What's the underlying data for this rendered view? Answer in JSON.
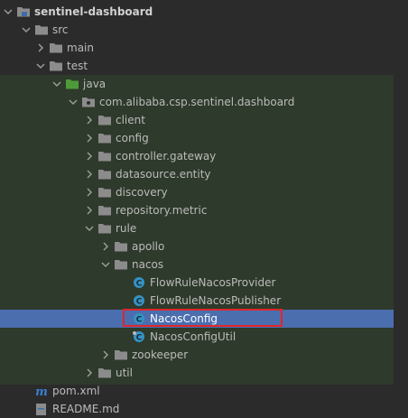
{
  "tree": {
    "root": "sentinel-dashboard",
    "src": "src",
    "main": "main",
    "test": "test",
    "java": "java",
    "package": "com.alibaba.csp.sentinel.dashboard",
    "client": "client",
    "config": "config",
    "controller_gateway": "controller.gateway",
    "datasource_entity": "datasource.entity",
    "discovery": "discovery",
    "repository_metric": "repository.metric",
    "rule": "rule",
    "apollo": "apollo",
    "nacos": "nacos",
    "flow_rule_nacos_provider": "FlowRuleNacosProvider",
    "flow_rule_nacos_publisher": "FlowRuleNacosPublisher",
    "nacos_config": "NacosConfig",
    "nacos_config_util": "NacosConfigUtil",
    "zookeeper": "zookeeper",
    "util": "util",
    "pom": "pom.xml",
    "readme": "README.md"
  },
  "colors": {
    "background": "#2b2b2b",
    "test_source_band": "#2e3a2b",
    "selection": "#4b6eaf",
    "highlight_border": "#e0262a",
    "class_icon": "#3592c4",
    "folder": "#8c8c8c",
    "test_folder": "#4e9a3b"
  }
}
